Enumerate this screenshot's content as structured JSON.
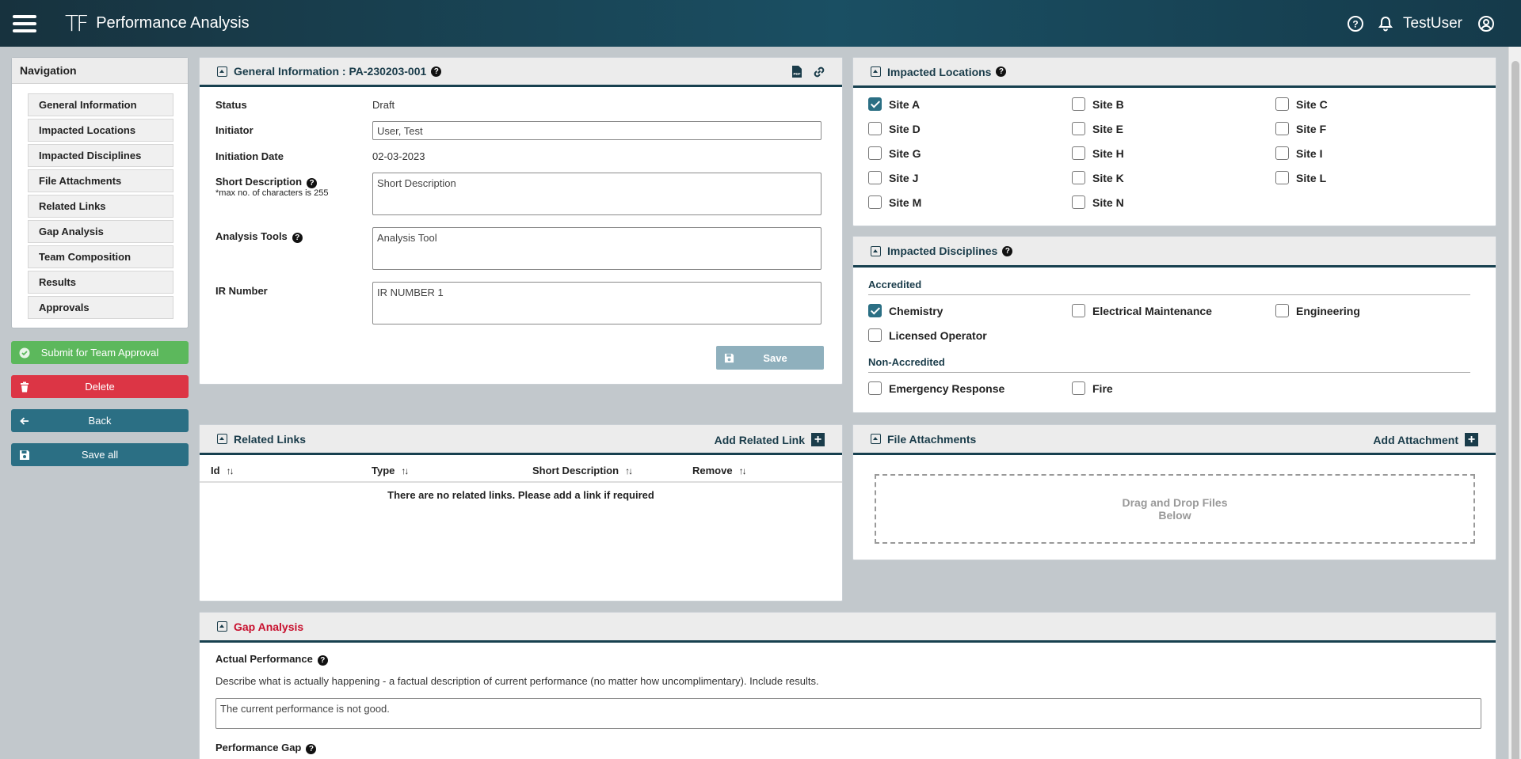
{
  "app": {
    "logo": "TF",
    "title": "Performance Analysis",
    "user": "TestUser"
  },
  "nav": {
    "title": "Navigation",
    "items": [
      "General Information",
      "Impacted Locations",
      "Impacted Disciplines",
      "File Attachments",
      "Related Links",
      "Gap Analysis",
      "Team Composition",
      "Results",
      "Approvals"
    ]
  },
  "actions": {
    "submit": "Submit for Team Approval",
    "delete": "Delete",
    "back": "Back",
    "save_all": "Save all"
  },
  "general": {
    "title": "General Information : PA-230203-001",
    "status_label": "Status",
    "status_value": "Draft",
    "initiator_label": "Initiator",
    "initiator_value": "User, Test",
    "date_label": "Initiation Date",
    "date_value": "02-03-2023",
    "short_label": "Short Description",
    "short_note": "*max no. of characters is 255",
    "short_placeholder": "Short Description",
    "tools_label": "Analysis Tools",
    "tools_placeholder": "Analysis Tool",
    "ir_label": "IR Number",
    "ir_value": "IR NUMBER 1",
    "save": "Save"
  },
  "locations": {
    "title": "Impacted Locations",
    "sites": [
      {
        "label": "Site A",
        "checked": true
      },
      {
        "label": "Site B",
        "checked": false
      },
      {
        "label": "Site C",
        "checked": false
      },
      {
        "label": "Site D",
        "checked": false
      },
      {
        "label": "Site E",
        "checked": false
      },
      {
        "label": "Site F",
        "checked": false
      },
      {
        "label": "Site G",
        "checked": false
      },
      {
        "label": "Site H",
        "checked": false
      },
      {
        "label": "Site I",
        "checked": false
      },
      {
        "label": "Site J",
        "checked": false
      },
      {
        "label": "Site K",
        "checked": false
      },
      {
        "label": "Site L",
        "checked": false
      },
      {
        "label": "Site M",
        "checked": false
      },
      {
        "label": "Site N",
        "checked": false
      }
    ]
  },
  "disciplines": {
    "title": "Impacted Disciplines",
    "accredited_label": "Accredited",
    "accredited": [
      {
        "label": "Chemistry",
        "checked": true
      },
      {
        "label": "Electrical Maintenance",
        "checked": false
      },
      {
        "label": "Engineering",
        "checked": false
      },
      {
        "label": "Licensed Operator",
        "checked": false
      }
    ],
    "non_accredited_label": "Non-Accredited",
    "non_accredited": [
      {
        "label": "Emergency Response",
        "checked": false
      },
      {
        "label": "Fire",
        "checked": false
      }
    ]
  },
  "related": {
    "title": "Related Links",
    "add": "Add Related Link",
    "columns": [
      "Id",
      "Type",
      "Short Description",
      "Remove"
    ],
    "empty": "There are no related links. Please add a link if required"
  },
  "files": {
    "title": "File Attachments",
    "add": "Add Attachment",
    "drop_line1": "Drag and Drop Files",
    "drop_line2": "Below"
  },
  "gap": {
    "title": "Gap Analysis",
    "actual_label": "Actual Performance",
    "actual_desc": "Describe what is actually happening - a factual description of current performance (no matter how uncomplimentary). Include results.",
    "actual_value": "The current performance is not good.",
    "gap_label": "Performance Gap"
  },
  "colors": {
    "header": "#1a4f63",
    "submit": "#5cb85c",
    "delete": "#dc3545",
    "primary": "#2b6f84",
    "gap_title": "#c8102e"
  }
}
